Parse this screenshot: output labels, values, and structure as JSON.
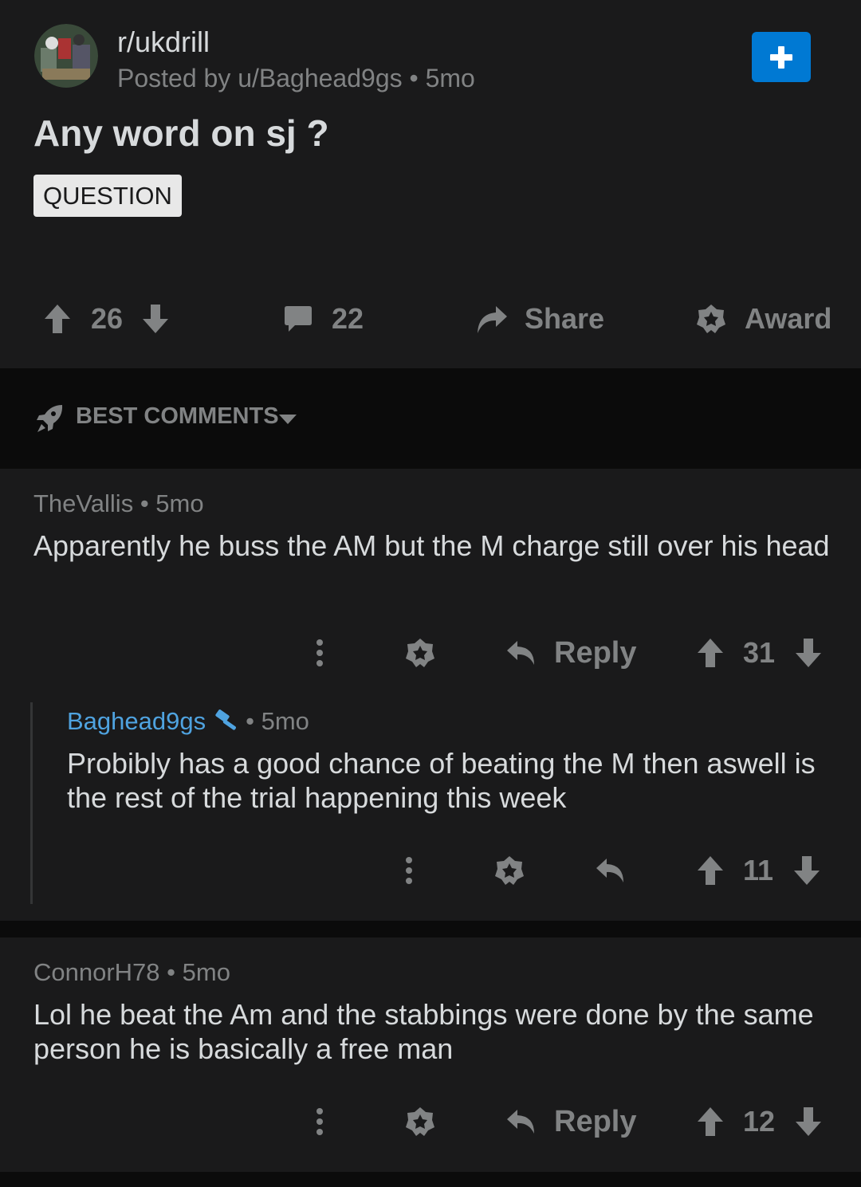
{
  "post": {
    "subreddit": "r/ukdrill",
    "meta": "Posted by u/Baghead9gs • 5mo",
    "title": "Any word on sj ?",
    "flair": "QUESTION",
    "upvotes": "26",
    "comments_count": "22",
    "share_label": "Share",
    "award_label": "Award"
  },
  "sort": {
    "label": "BEST COMMENTS"
  },
  "comments": [
    {
      "author": "TheVallis",
      "age": "• 5mo",
      "body": "Apparently he buss the AM but the M charge still over his head",
      "reply_label": "Reply",
      "score": "31"
    },
    {
      "author": "Baghead9gs",
      "age": "• 5mo",
      "body": "Probibly has a good chance of beating the M then aswell is the rest of the trial happening this week",
      "score": "11"
    },
    {
      "author": "ConnorH78",
      "age": "• 5mo",
      "body": "Lol he beat the Am and the stabbings were done by the same person he is basically a free man",
      "reply_label": "Reply",
      "score": "12"
    }
  ],
  "colors": {
    "background": "#1a1a1b",
    "accent": "#0079d3",
    "op_name": "#4fa3e0",
    "muted": "#818384"
  },
  "icons": [
    "upvote-icon",
    "downvote-icon",
    "comment-icon",
    "share-icon",
    "award-icon",
    "rocket-icon",
    "caret-down-icon",
    "more-icon",
    "reply-icon",
    "mod-hammer-icon",
    "plus-icon"
  ]
}
